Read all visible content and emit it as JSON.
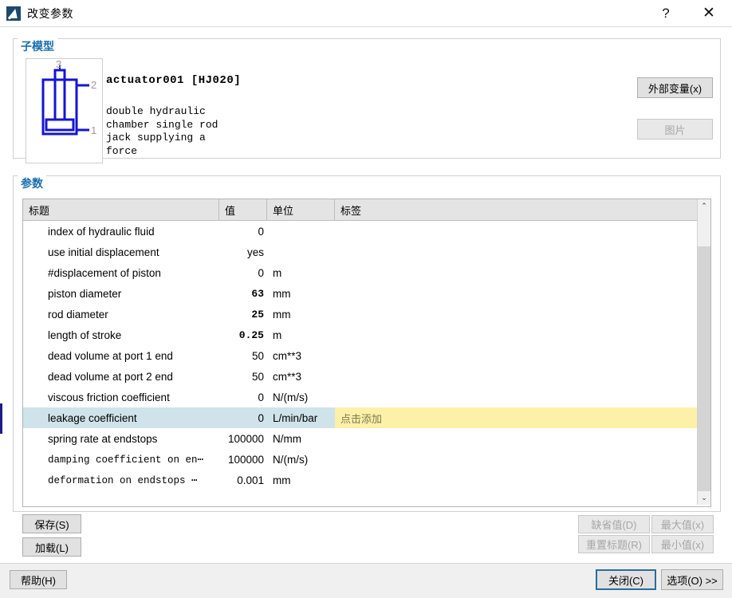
{
  "window": {
    "title": "改变参数",
    "icon": "app-icon",
    "help_label": "?",
    "close_label": "✕"
  },
  "submodel": {
    "group_title": "子模型",
    "name": "actuator001 [HJ020]",
    "description": "double hydraulic\nchamber single rod\njack supplying a\nforce",
    "icon_ports": [
      "3",
      "2",
      "1"
    ],
    "ext_var_button": "外部变量(x)",
    "image_button": "图片"
  },
  "parameters": {
    "group_title": "参数",
    "columns": [
      "标题",
      "值",
      "单位",
      "标签"
    ],
    "tag_placeholder": "点击添加",
    "rows": [
      {
        "title": "index of hydraulic fluid",
        "value": "0",
        "unit": "",
        "label": "",
        "bold": false,
        "mono": false,
        "selected": false
      },
      {
        "title": "use initial displacement",
        "value": "yes",
        "unit": "",
        "label": "",
        "bold": false,
        "mono": false,
        "selected": false
      },
      {
        "title": "#displacement of piston",
        "value": "0",
        "unit": "m",
        "label": "",
        "bold": false,
        "mono": false,
        "selected": false
      },
      {
        "title": "piston diameter",
        "value": "63",
        "unit": "mm",
        "label": "",
        "bold": true,
        "mono": false,
        "selected": false
      },
      {
        "title": "rod diameter",
        "value": "25",
        "unit": "mm",
        "label": "",
        "bold": true,
        "mono": false,
        "selected": false
      },
      {
        "title": "length of stroke",
        "value": "0.25",
        "unit": "m",
        "label": "",
        "bold": true,
        "mono": false,
        "selected": false
      },
      {
        "title": "dead volume at port 1 end",
        "value": "50",
        "unit": "cm**3",
        "label": "",
        "bold": false,
        "mono": false,
        "selected": false
      },
      {
        "title": "dead volume at port 2 end",
        "value": "50",
        "unit": "cm**3",
        "label": "",
        "bold": false,
        "mono": false,
        "selected": false
      },
      {
        "title": "viscous friction coefficient",
        "value": "0",
        "unit": "N/(m/s)",
        "label": "",
        "bold": false,
        "mono": false,
        "selected": false
      },
      {
        "title": "leakage coefficient",
        "value": "0",
        "unit": "L/min/bar",
        "label": "点击添加",
        "bold": false,
        "mono": false,
        "selected": true
      },
      {
        "title": "spring rate at endstops",
        "value": "100000",
        "unit": "N/mm",
        "label": "",
        "bold": false,
        "mono": false,
        "selected": false
      },
      {
        "title": "damping coefficient on en⋯",
        "value": "100000",
        "unit": "N/(m/s)",
        "label": "",
        "bold": false,
        "mono": true,
        "selected": false
      },
      {
        "title": "deformation on endstops ⋯",
        "value": "0.001",
        "unit": "mm",
        "label": "",
        "bold": false,
        "mono": true,
        "selected": false
      }
    ],
    "scroll_up": "⌃",
    "scroll_down": "⌄"
  },
  "actions": {
    "save": "保存(S)",
    "load": "加载(L)",
    "default_value": "缺省值(D)",
    "max_value": "最大值(x)",
    "reset_title": "重置标题(R)",
    "min_value": "最小值(x)",
    "help": "帮助(H)",
    "close": "关闭(C)",
    "options": "选项(O) >>"
  },
  "colors": {
    "group_title": "#1a6fad",
    "selection": "#cfe3ea",
    "tag_highlight": "#fdf0a8",
    "icon_blue": "#1414d2",
    "focus_border": "#2a6d9e"
  }
}
